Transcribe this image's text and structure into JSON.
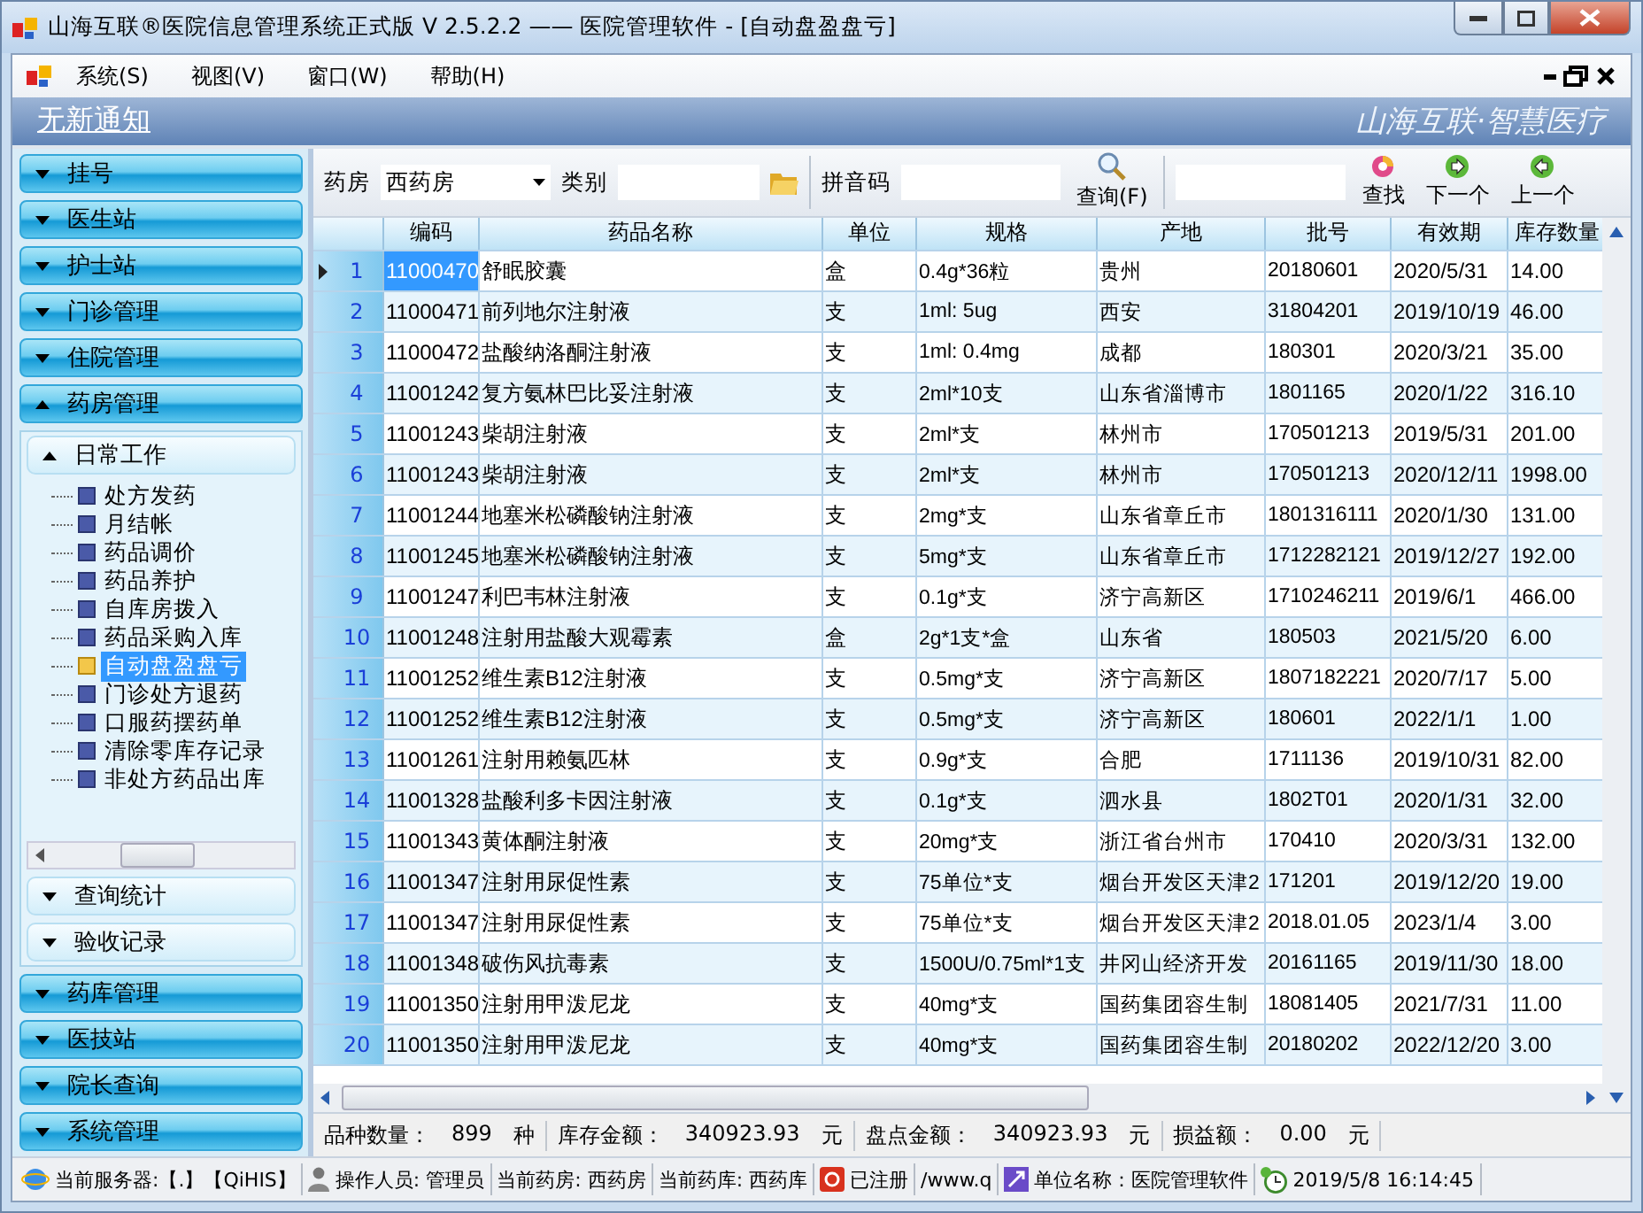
{
  "window": {
    "title": "山海互联®医院信息管理系统正式版 V 2.5.2.2 —— 医院管理软件 - [自动盘盈盘亏]"
  },
  "menu": [
    "系统(S)",
    "视图(V)",
    "窗口(W)",
    "帮助(H)"
  ],
  "banner": {
    "notice": "无新通知",
    "slogan": "山海互联·智慧医疗"
  },
  "sidebar": {
    "sections": [
      {
        "label": "挂号",
        "expanded": false
      },
      {
        "label": "医生站",
        "expanded": false
      },
      {
        "label": "护士站",
        "expanded": false
      },
      {
        "label": "门诊管理",
        "expanded": false
      },
      {
        "label": "住院管理",
        "expanded": false
      },
      {
        "label": "药房管理",
        "expanded": true,
        "groups": [
          {
            "label": "日常工作",
            "expanded": true,
            "items": [
              {
                "label": "处方发药",
                "selected": false
              },
              {
                "label": "月结帐",
                "selected": false
              },
              {
                "label": "药品调价",
                "selected": false
              },
              {
                "label": "药品养护",
                "selected": false
              },
              {
                "label": "自库房拨入",
                "selected": false
              },
              {
                "label": "药品采购入库",
                "selected": false
              },
              {
                "label": "自动盘盈盘亏",
                "selected": true
              },
              {
                "label": "门诊处方退药",
                "selected": false
              },
              {
                "label": "口服药摆药单",
                "selected": false
              },
              {
                "label": "清除零库存记录",
                "selected": false
              },
              {
                "label": "非处方药品出库",
                "selected": false
              }
            ]
          },
          {
            "label": "查询统计",
            "expanded": false
          },
          {
            "label": "验收记录",
            "expanded": false
          }
        ]
      },
      {
        "label": "药库管理",
        "expanded": false
      },
      {
        "label": "医技站",
        "expanded": false
      },
      {
        "label": "院长查询",
        "expanded": false
      },
      {
        "label": "系统管理",
        "expanded": false
      }
    ]
  },
  "toolbar": {
    "fields": [
      {
        "kind": "dropdown",
        "label": "药房",
        "value": "西药房"
      },
      {
        "kind": "folder",
        "label": "类别"
      },
      {
        "kind": "text",
        "label": "拼音码"
      }
    ],
    "query_button": "查询(F)",
    "buttons": [
      {
        "kind": "find",
        "label": "查找"
      },
      {
        "kind": "next",
        "label": "下一个"
      },
      {
        "kind": "prev",
        "label": "上一个"
      }
    ]
  },
  "table": {
    "columns": [
      "编码",
      "药品名称",
      "单位",
      "规格",
      "产地",
      "批号",
      "有效期",
      "库存数量"
    ],
    "rows": [
      {
        "n": "1",
        "selected": true,
        "cells": [
          "11000470",
          "舒眠胶囊",
          "盒",
          "0.4g*36粒",
          "贵州",
          "20180601",
          "2020/5/31",
          "14.00"
        ]
      },
      {
        "n": "2",
        "selected": false,
        "cells": [
          "11000471",
          "前列地尔注射液",
          "支",
          "1ml: 5ug",
          "西安",
          "31804201",
          "2019/10/19",
          "46.00"
        ]
      },
      {
        "n": "3",
        "selected": false,
        "cells": [
          "11000472",
          "盐酸纳洛酮注射液",
          "支",
          "1ml: 0.4mg",
          "成都",
          "180301",
          "2020/3/21",
          "35.00"
        ]
      },
      {
        "n": "4",
        "selected": false,
        "cells": [
          "11001242",
          "复方氨林巴比妥注射液",
          "支",
          "2ml*10支",
          "山东省淄博市",
          "1801165",
          "2020/1/22",
          "316.10"
        ]
      },
      {
        "n": "5",
        "selected": false,
        "cells": [
          "11001243",
          "柴胡注射液",
          "支",
          "2ml*支",
          "林州市",
          "170501213",
          "2019/5/31",
          "201.00"
        ]
      },
      {
        "n": "6",
        "selected": false,
        "cells": [
          "11001243",
          "柴胡注射液",
          "支",
          "2ml*支",
          "林州市",
          "170501213",
          "2020/12/11",
          "1998.00"
        ]
      },
      {
        "n": "7",
        "selected": false,
        "cells": [
          "11001244",
          "地塞米松磷酸钠注射液",
          "支",
          "2mg*支",
          "山东省章丘市",
          "1801316111",
          "2020/1/30",
          "131.00"
        ]
      },
      {
        "n": "8",
        "selected": false,
        "cells": [
          "11001245",
          "地塞米松磷酸钠注射液",
          "支",
          "5mg*支",
          "山东省章丘市",
          "1712282121",
          "2019/12/27",
          "192.00"
        ]
      },
      {
        "n": "9",
        "selected": false,
        "cells": [
          "11001247",
          "利巴韦林注射液",
          "支",
          "0.1g*支",
          "济宁高新区",
          "1710246211",
          "2019/6/1",
          "466.00"
        ]
      },
      {
        "n": "10",
        "selected": false,
        "cells": [
          "11001248",
          "注射用盐酸大观霉素",
          "盒",
          "2g*1支*盒",
          "山东省",
          "180503",
          "2021/5/20",
          "6.00"
        ]
      },
      {
        "n": "11",
        "selected": false,
        "cells": [
          "11001252",
          "维生素B12注射液",
          "支",
          "0.5mg*支",
          "济宁高新区",
          "1807182221",
          "2020/7/17",
          "5.00"
        ]
      },
      {
        "n": "12",
        "selected": false,
        "cells": [
          "11001252",
          "维生素B12注射液",
          "支",
          "0.5mg*支",
          "济宁高新区",
          "180601",
          "2022/1/1",
          "1.00"
        ]
      },
      {
        "n": "13",
        "selected": false,
        "cells": [
          "11001261",
          "注射用赖氨匹林",
          "支",
          "0.9g*支",
          "合肥",
          "1711136",
          "2019/10/31",
          "82.00"
        ]
      },
      {
        "n": "14",
        "selected": false,
        "cells": [
          "11001328",
          "盐酸利多卡因注射液",
          "支",
          "0.1g*支",
          "泗水县",
          "1802T01",
          "2020/1/31",
          "32.00"
        ]
      },
      {
        "n": "15",
        "selected": false,
        "cells": [
          "11001343",
          "黄体酮注射液",
          "支",
          "20mg*支",
          "浙江省台州市",
          "170410",
          "2020/3/31",
          "132.00"
        ]
      },
      {
        "n": "16",
        "selected": false,
        "cells": [
          "11001347",
          "注射用尿促性素",
          "支",
          "75单位*支",
          "烟台开发区天津2",
          "171201",
          "2019/12/20",
          "19.00"
        ]
      },
      {
        "n": "17",
        "selected": false,
        "cells": [
          "11001347",
          "注射用尿促性素",
          "支",
          "75单位*支",
          "烟台开发区天津2",
          "2018.01.05",
          "2023/1/4",
          "3.00"
        ]
      },
      {
        "n": "18",
        "selected": false,
        "cells": [
          "11001348",
          "破伤风抗毒素",
          "支",
          "1500U/0.75ml*1支",
          "井冈山经济开发",
          "20161165",
          "2019/11/30",
          "18.00"
        ]
      },
      {
        "n": "19",
        "selected": false,
        "cells": [
          "11001350",
          "注射用甲泼尼龙",
          "支",
          "40mg*支",
          "国药集团容生制",
          "18081405",
          "2021/7/31",
          "11.00"
        ]
      },
      {
        "n": "20",
        "selected": false,
        "cells": [
          "11001350",
          "注射用甲泼尼龙",
          "支",
          "40mg*支",
          "国药集团容生制",
          "20180202",
          "2022/12/20",
          "3.00"
        ]
      }
    ]
  },
  "summary": [
    {
      "label": "品种数量：",
      "value": "899",
      "unit": "种"
    },
    {
      "label": "库存金额：",
      "value": "340923.93",
      "unit": "元"
    },
    {
      "label": "盘点金额：",
      "value": "340923.93",
      "unit": "元"
    },
    {
      "label": "损益额：",
      "value": "0.00",
      "unit": "元"
    }
  ],
  "status_bar": [
    {
      "kind": "globe",
      "text": "当前服务器:【.】【QiHIS】"
    },
    {
      "kind": "person",
      "text": "操作人员: 管理员"
    },
    {
      "kind": "plain",
      "text": "当前药房:  西药房"
    },
    {
      "kind": "plain",
      "text": "当前药库:   西药库"
    },
    {
      "kind": "registered",
      "text": "已注册"
    },
    {
      "kind": "plain",
      "text": "/www.q"
    },
    {
      "kind": "unit",
      "text": "单位名称：医院管理软件"
    },
    {
      "kind": "clock",
      "text": "2019/5/8 16:14:45"
    }
  ]
}
